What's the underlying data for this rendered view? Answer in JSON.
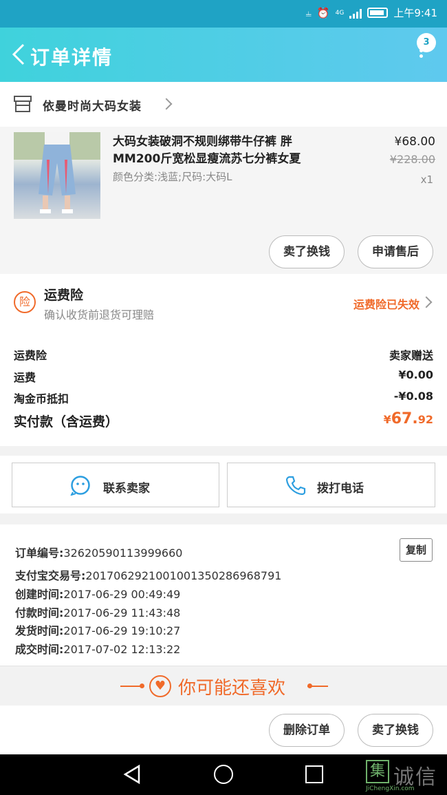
{
  "status_bar": {
    "network": "4G",
    "time": "上午9:41"
  },
  "header": {
    "title": "订单详情",
    "badge_count": "3"
  },
  "store": {
    "name": "依曼时尚大码女装"
  },
  "product": {
    "name": "大码女装破洞不规则绑带牛仔裤 胖MM200斤宽松显瘦流苏七分裤女夏",
    "sku": "颜色分类:浅蓝;尺码:大码L",
    "price": "¥68.00",
    "original_price": "¥228.00",
    "quantity": "x1",
    "buttons": {
      "exchange": "卖了换钱",
      "after_sale": "申请售后"
    }
  },
  "insurance": {
    "icon_char": "险",
    "title": "运费险",
    "subtitle": "确认收货前退货可理赔",
    "status": "运费险已失效"
  },
  "fees": [
    {
      "label": "运费险",
      "value": "卖家赠送"
    },
    {
      "label": "运费",
      "value": "¥0.00"
    },
    {
      "label": "淘金币抵扣",
      "value": "-¥0.08"
    }
  ],
  "total": {
    "label": "实付款（含运费）",
    "currency": "¥",
    "integer": "67.",
    "decimal": "92"
  },
  "contact": {
    "seller_label": "联系卖家",
    "call_label": "拨打电话"
  },
  "order_info": {
    "order_no_label": "订单编号:",
    "order_no": "32620590113999660",
    "copy_label": "复制",
    "alipay_label": "支付宝交易号:",
    "alipay_no": "2017062921001001350286968791",
    "created_label": "创建时间:",
    "created": "2017-06-29 00:49:49",
    "paid_label": "付款时间:",
    "paid": "2017-06-29 11:43:48",
    "shipped_label": "发货时间:",
    "shipped": "2017-06-29 19:10:27",
    "completed_label": "成交时间:",
    "completed": "2017-07-02 12:13:22"
  },
  "recommend": {
    "title": "你可能还喜欢"
  },
  "bottom_actions": {
    "delete": "删除订单",
    "sell": "卖了换钱"
  },
  "watermark": {
    "box_char": "集",
    "text": "诚信",
    "url": "JiChengXin.com"
  },
  "colors": {
    "accent": "#f06a2a",
    "header_start": "#3fd2dc",
    "header_end": "#5fc9ee",
    "status_bar": "#1fa3c5"
  }
}
